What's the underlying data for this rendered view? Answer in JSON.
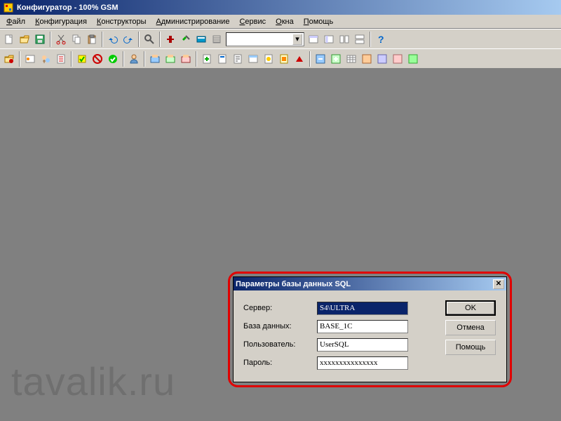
{
  "title": "Конфигуратор - 100% GSM",
  "menu": [
    "Файл",
    "Конфигурация",
    "Конструкторы",
    "Администрирование",
    "Сервис",
    "Окна",
    "Помощь"
  ],
  "watermark": "tavalik.ru",
  "dialog": {
    "title": "Параметры базы данных SQL",
    "labels": {
      "server": "Сервер:",
      "db": "База данных:",
      "user": "Пользователь:",
      "pw": "Пароль:"
    },
    "values": {
      "server": "S4\\ULTRA",
      "db": "BASE_1C",
      "user": "UserSQL",
      "pw": "xxxxxxxxxxxxxxx"
    },
    "buttons": {
      "ok": "OK",
      "cancel": "Отмена",
      "help": "Помощь"
    }
  }
}
